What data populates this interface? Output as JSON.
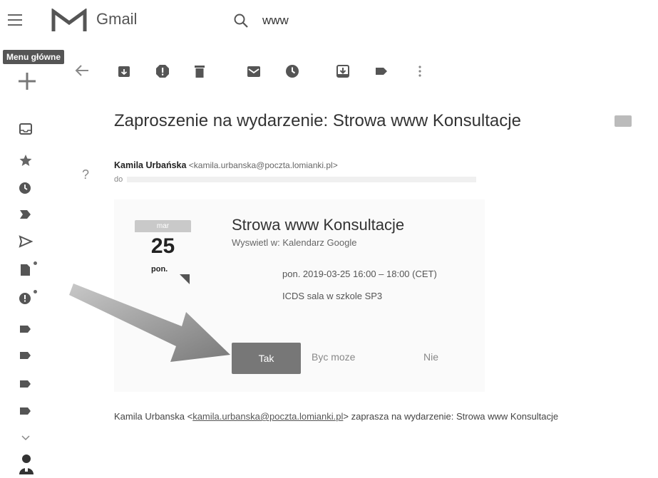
{
  "header": {
    "app_name": "Gmail",
    "search_value": "www",
    "menu_tooltip": "Menu główne"
  },
  "message": {
    "subject": "Zaproszenie na wydarzenie: Strowa www Konsultacje",
    "sender_name": "Kamila Urbańska",
    "sender_email": "<kamila.urbanska@poczta.lomianki.pl>",
    "to_label": "do",
    "help": "?"
  },
  "invite": {
    "month": "mar",
    "day": "25",
    "weekday": "pon.",
    "title": "Strowa www Konsultacje",
    "view_in_calendar": "Wyswietl w: Kalendarz Google",
    "time": "pon. 2019-03-25 16:00 – 18:00 (CET)",
    "location": "ICDS sala w szkole SP3",
    "rsvp": {
      "yes": "Tak",
      "maybe": "Byc moze",
      "no": "Nie"
    }
  },
  "footer": {
    "sender_name": "Kamila Urbanska <",
    "email_link": "kamila.urbanska@poczta.lomianki.pl",
    "rest": "> zaprasza na wydarzenie: Strowa www Konsultacje"
  },
  "colors": {
    "primary_button": "#777777",
    "arrow": "#8a8a8a"
  }
}
